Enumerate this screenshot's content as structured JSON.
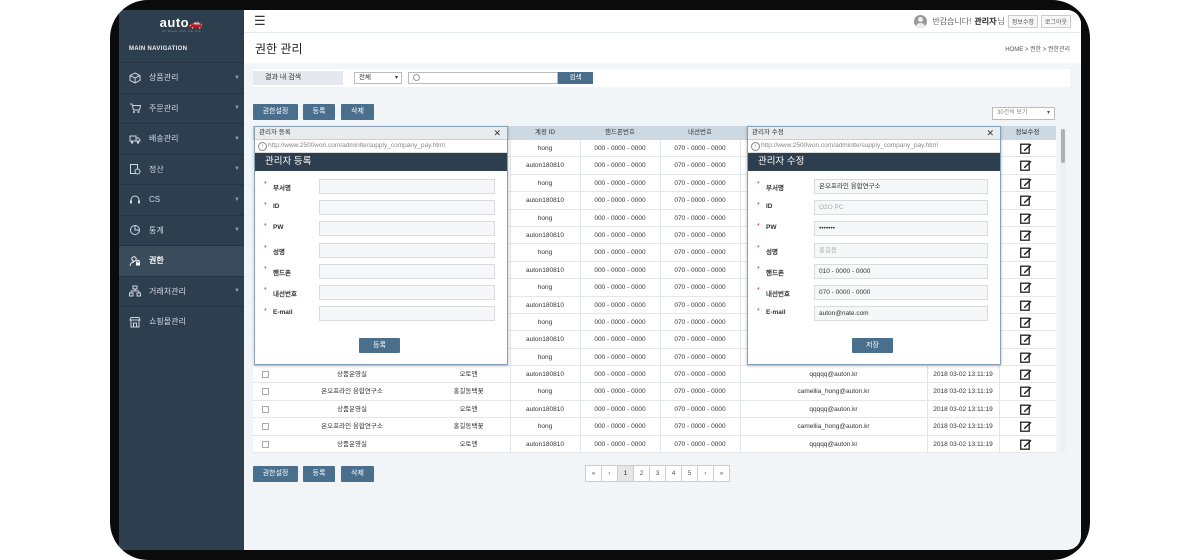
{
  "logo": {
    "text": "auto",
    "sub": "all about your car life"
  },
  "nav": {
    "title": "MAIN NAVIGATION",
    "items": [
      {
        "label": "상품관리",
        "icon": "cube-icon",
        "arrow": true,
        "active": false
      },
      {
        "label": "주문관리",
        "icon": "cart-icon",
        "arrow": true,
        "active": false
      },
      {
        "label": "배송관리",
        "icon": "truck-icon",
        "arrow": true,
        "active": false
      },
      {
        "label": "정산",
        "icon": "settlement-icon",
        "arrow": true,
        "active": false
      },
      {
        "label": "CS",
        "icon": "headset-icon",
        "arrow": true,
        "active": false
      },
      {
        "label": "통계",
        "icon": "pie-chart-icon",
        "arrow": true,
        "active": false
      },
      {
        "label": "권한",
        "icon": "user-lock-icon",
        "arrow": false,
        "active": true
      },
      {
        "label": "거래처관리",
        "icon": "org-chart-icon",
        "arrow": true,
        "active": false
      },
      {
        "label": "쇼핑몰관리",
        "icon": "store-icon",
        "arrow": false,
        "active": false
      }
    ]
  },
  "header": {
    "greeting": "반갑습니다!",
    "user_name": "관리자",
    "honorific": "님",
    "info_btn": "정보수정",
    "logout_btn": "로그아웃"
  },
  "page": {
    "title": "권한 관리",
    "breadcrumb": "HOME  >  권한  >  권한관리"
  },
  "search": {
    "label": "결과 내 검색",
    "select_value": "전체",
    "input_value": "",
    "button": "검색"
  },
  "actions": {
    "perm": "권한설정",
    "register": "등록",
    "delete": "삭제",
    "per_page": "30건씩 보기"
  },
  "table": {
    "headers": [
      "계정 ID",
      "핸드폰번호",
      "내선번호",
      "정보수정"
    ],
    "rows": [
      {
        "dept": "",
        "name": "",
        "id": "hong",
        "phone": "000 - 0000 - 0000",
        "ext": "070 - 0000 - 0000",
        "email": "",
        "date": ""
      },
      {
        "dept": "",
        "name": "",
        "id": "auton180810",
        "phone": "000 - 0000 - 0000",
        "ext": "070 - 0000 - 0000",
        "email": "",
        "date": ""
      },
      {
        "dept": "",
        "name": "",
        "id": "hong",
        "phone": "000 - 0000 - 0000",
        "ext": "070 - 0000 - 0000",
        "email": "",
        "date": ""
      },
      {
        "dept": "",
        "name": "",
        "id": "auton180810",
        "phone": "000 - 0000 - 0000",
        "ext": "070 - 0000 - 0000",
        "email": "",
        "date": ""
      },
      {
        "dept": "",
        "name": "",
        "id": "hong",
        "phone": "000 - 0000 - 0000",
        "ext": "070 - 0000 - 0000",
        "email": "",
        "date": ""
      },
      {
        "dept": "",
        "name": "",
        "id": "auton180810",
        "phone": "000 - 0000 - 0000",
        "ext": "070 - 0000 - 0000",
        "email": "",
        "date": ""
      },
      {
        "dept": "",
        "name": "",
        "id": "hong",
        "phone": "000 - 0000 - 0000",
        "ext": "070 - 0000 - 0000",
        "email": "",
        "date": ""
      },
      {
        "dept": "",
        "name": "",
        "id": "auton180810",
        "phone": "000 - 0000 - 0000",
        "ext": "070 - 0000 - 0000",
        "email": "",
        "date": ""
      },
      {
        "dept": "",
        "name": "",
        "id": "hong",
        "phone": "000 - 0000 - 0000",
        "ext": "070 - 0000 - 0000",
        "email": "",
        "date": ""
      },
      {
        "dept": "",
        "name": "",
        "id": "auton180810",
        "phone": "000 - 0000 - 0000",
        "ext": "070 - 0000 - 0000",
        "email": "",
        "date": ""
      },
      {
        "dept": "",
        "name": "",
        "id": "hong",
        "phone": "000 - 0000 - 0000",
        "ext": "070 - 0000 - 0000",
        "email": "",
        "date": ""
      },
      {
        "dept": "",
        "name": "",
        "id": "auton180810",
        "phone": "000 - 0000 - 0000",
        "ext": "070 - 0000 - 0000",
        "email": "",
        "date": ""
      },
      {
        "dept": "",
        "name": "",
        "id": "hong",
        "phone": "000 - 0000 - 0000",
        "ext": "070 - 0000 - 0000",
        "email": "",
        "date": ""
      },
      {
        "dept": "상품운영실",
        "name": "오토앤",
        "id": "auton180810",
        "phone": "000 - 0000 - 0000",
        "ext": "070 - 0000 - 0000",
        "email": "qqqqq@auton.kr",
        "date": "2018 03-02   13:11:19"
      },
      {
        "dept": "온오프라인 융합연구소",
        "name": "홍길동백꽃",
        "id": "hong",
        "phone": "000 - 0000 - 0000",
        "ext": "070 - 0000 - 0000",
        "email": "camellia_hong@auton.kr",
        "date": "2018 03-02   13:11:19"
      },
      {
        "dept": "상품운영실",
        "name": "오토앤",
        "id": "auton180810",
        "phone": "000 - 0000 - 0000",
        "ext": "070 - 0000 - 0000",
        "email": "qqqqq@auton.kr",
        "date": "2018 03-02   13:11:19"
      },
      {
        "dept": "온오프라인 융합연구소",
        "name": "홍길동백꽃",
        "id": "hong",
        "phone": "000 - 0000 - 0000",
        "ext": "070 - 0000 - 0000",
        "email": "camellia_hong@auton.kr",
        "date": "2018 03-02   13:11:19"
      },
      {
        "dept": "상품운영실",
        "name": "오토앤",
        "id": "auton180810",
        "phone": "000 - 0000 - 0000",
        "ext": "070 - 0000 - 0000",
        "email": "qqqqq@auton.kr",
        "date": "2018 03-02   13:11:19"
      }
    ]
  },
  "pagination": {
    "first": "«",
    "prev": "‹",
    "pages": [
      "1",
      "2",
      "3",
      "4",
      "5"
    ],
    "current": "1",
    "next": "›",
    "last": "»"
  },
  "popup_register": {
    "window_title": "관리자 등록",
    "close": "✕",
    "url": "http://www.2500won.com/adminlte/supply_company_pay.html",
    "heading": "관리자 등록",
    "fields": [
      {
        "label": "부서명",
        "value": "",
        "placeholder": ""
      },
      {
        "label": "ID",
        "value": "",
        "placeholder": ""
      },
      {
        "label": "PW",
        "value": "",
        "placeholder": ""
      },
      {
        "label": "성명",
        "value": "",
        "placeholder": ""
      },
      {
        "label": "핸드폰",
        "value": "",
        "placeholder": ""
      },
      {
        "label": "내선번호",
        "value": "",
        "placeholder": ""
      },
      {
        "label": "E-mail",
        "value": "",
        "placeholder": ""
      }
    ],
    "button": "등록"
  },
  "popup_edit": {
    "window_title": "관리자 수정",
    "close": "✕",
    "url": "http://www.2500won.com/adminlte/supply_company_pay.html",
    "heading": "관리자 수정",
    "fields": [
      {
        "label": "부서명",
        "value": "온오프라인 융합연구소",
        "placeholder": ""
      },
      {
        "label": "ID",
        "value": "",
        "placeholder": "O2O PC"
      },
      {
        "label": "PW",
        "value": "•••••••",
        "placeholder": ""
      },
      {
        "label": "성명",
        "value": "",
        "placeholder": "홍길동"
      },
      {
        "label": "핸드폰",
        "value": "010 - 0000 - 0000",
        "placeholder": ""
      },
      {
        "label": "내선번호",
        "value": "070 - 0000 - 0000",
        "placeholder": ""
      },
      {
        "label": "E-mail",
        "value": "auton@nate.com",
        "placeholder": ""
      }
    ],
    "button": "저장"
  }
}
